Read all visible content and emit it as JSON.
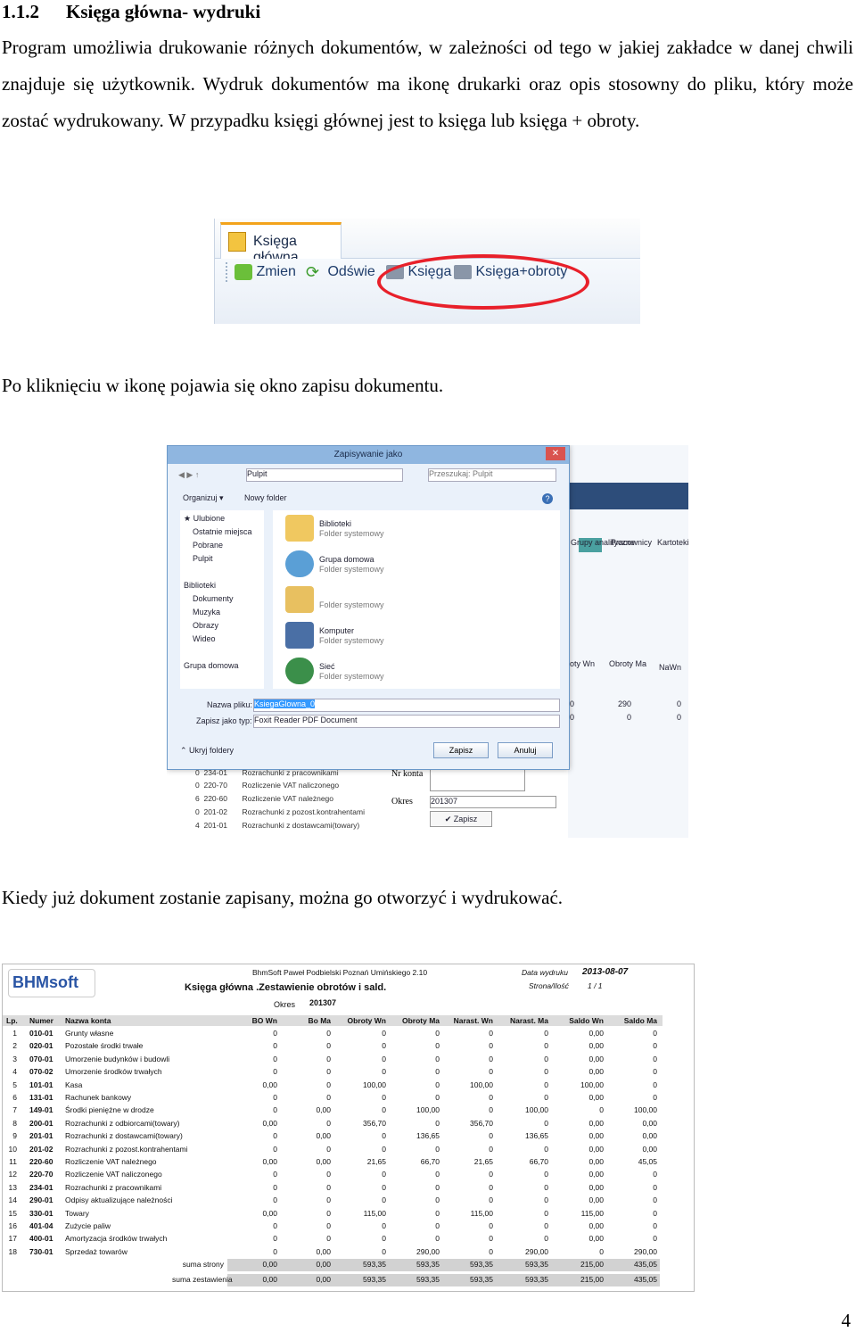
{
  "heading": {
    "number": "1.1.2",
    "title": "Księga główna- wydruki"
  },
  "paragraphs": [
    "Program umożliwia drukowanie różnych dokumentów, w zależności od tego w jakiej zakładce w danej chwili znajduje się użytkownik. Wydruk dokumentów ma ikonę drukarki oraz opis stosowny do pliku, który może zostać wydrukowany. W przypadku księgi głównej jest to księga lub księga + obroty.",
    "Po kliknięciu w ikonę pojawia się okno zapisu dokumentu.",
    "Kiedy już dokument zostanie zapisany, można go otworzyć i wydrukować."
  ],
  "toolbar": {
    "tab_label": "Księga główna",
    "buttons": [
      "Zmien",
      "Odśwież",
      "Księga",
      "Księga+obroty"
    ],
    "visible_refresh": "Odświe"
  },
  "save_dialog": {
    "title": "Zapisywanie jako",
    "close": "✕",
    "path": "Pulpit",
    "search_placeholder": "Przeszukaj: Pulpit",
    "organize": "Organizuj ▾",
    "new_folder": "Nowy folder",
    "nav_items": [
      "Ulubione",
      "Ostatnie miejsca",
      "Pobrane",
      "Pulpit",
      "Biblioteki",
      "Dokumenty",
      "Muzyka",
      "Obrazy",
      "Wideo",
      "Grupa domowa"
    ],
    "files": [
      {
        "name": "Biblioteki",
        "type": "Folder systemowy"
      },
      {
        "name": "Grupa domowa",
        "type": "Folder systemowy"
      },
      {
        "name": "",
        "type": "Folder systemowy"
      },
      {
        "name": "Komputer",
        "type": "Folder systemowy"
      },
      {
        "name": "Sieć",
        "type": "Folder systemowy"
      }
    ],
    "filename_label": "Nazwa pliku:",
    "filename_value": "KsiegaGlowna_0",
    "filetype_label": "Zapisz jako typ:",
    "filetype_value": "Foxit Reader PDF Document",
    "hide_folders": "Ukryj foldery",
    "save_button": "Zapisz",
    "cancel_button": "Anuluj"
  },
  "background_app": {
    "ribbon": [
      "Grupy analityczne",
      "Pracownicy",
      "Kartoteki analityczne"
    ],
    "columns": [
      "oty Wn",
      "Obroty Ma",
      "NaWn"
    ],
    "row1": [
      "0",
      "290",
      "0"
    ],
    "row2": [
      "0",
      "0",
      "0"
    ],
    "rows": [
      {
        "lp": "0",
        "num": "234-01",
        "name": "Rozrachunki z pracownikami"
      },
      {
        "lp": "0",
        "num": "220-70",
        "name": "Rozliczenie VAT naliczonego"
      },
      {
        "lp": "6",
        "num": "220-60",
        "name": "Rozliczenie VAT należnego"
      },
      {
        "lp": "0",
        "num": "201-02",
        "name": "Rozrachunki z pozost.kontrahentami"
      },
      {
        "lp": "4",
        "num": "201-01",
        "name": "Rozrachunki z dostawcami(towary)"
      }
    ],
    "account_label": "Nr konta",
    "period_label": "Okres",
    "period_value": "201307",
    "save_label": "Zapisz"
  },
  "report": {
    "logo": "BHMsoft",
    "company": "BhmSoft Paweł Podbielski Poznań Umińskiego 2.10",
    "title": "Księga główna .Zestawienie obrotów i sald.",
    "period_label": "Okres",
    "period": "201307",
    "print_date_label": "Data wydruku",
    "print_date": "2013-08-07",
    "page_label": "Strona/Ilość",
    "page_value": "1 / 1",
    "columns": [
      "Lp.",
      "Numer",
      "Nazwa konta",
      "BO Wn",
      "Bo Ma",
      "Obroty Wn",
      "Obroty Ma",
      "Narast. Wn",
      "Narast. Ma",
      "Saldo Wn",
      "Saldo Ma"
    ],
    "rows": [
      [
        "1",
        "010-01",
        "Grunty własne",
        "0",
        "0",
        "0",
        "0",
        "0",
        "0",
        "0,00",
        "0"
      ],
      [
        "2",
        "020-01",
        "Pozostałe środki trwałe",
        "0",
        "0",
        "0",
        "0",
        "0",
        "0",
        "0,00",
        "0"
      ],
      [
        "3",
        "070-01",
        "Umorzenie budynków i budowli",
        "0",
        "0",
        "0",
        "0",
        "0",
        "0",
        "0,00",
        "0"
      ],
      [
        "4",
        "070-02",
        "Umorzenie środków trwałych",
        "0",
        "0",
        "0",
        "0",
        "0",
        "0",
        "0,00",
        "0"
      ],
      [
        "5",
        "101-01",
        "Kasa",
        "0,00",
        "0",
        "100,00",
        "0",
        "100,00",
        "0",
        "100,00",
        "0"
      ],
      [
        "6",
        "131-01",
        "Rachunek bankowy",
        "0",
        "0",
        "0",
        "0",
        "0",
        "0",
        "0,00",
        "0"
      ],
      [
        "7",
        "149-01",
        "Środki pieniężne w drodze",
        "0",
        "0,00",
        "0",
        "100,00",
        "0",
        "100,00",
        "0",
        "100,00"
      ],
      [
        "8",
        "200-01",
        "Rozrachunki z odbiorcami(towary)",
        "0,00",
        "0",
        "356,70",
        "0",
        "356,70",
        "0",
        "0,00",
        "0,00"
      ],
      [
        "9",
        "201-01",
        "Rozrachunki z dostawcami(towary)",
        "0",
        "0,00",
        "0",
        "136,65",
        "0",
        "136,65",
        "0,00",
        "0,00"
      ],
      [
        "10",
        "201-02",
        "Rozrachunki z pozost.kontrahentami",
        "0",
        "0",
        "0",
        "0",
        "0",
        "0",
        "0,00",
        "0,00"
      ],
      [
        "11",
        "220-60",
        "Rozliczenie VAT należnego",
        "0,00",
        "0,00",
        "21,65",
        "66,70",
        "21,65",
        "66,70",
        "0,00",
        "45,05"
      ],
      [
        "12",
        "220-70",
        "Rozliczenie VAT naliczonego",
        "0",
        "0",
        "0",
        "0",
        "0",
        "0",
        "0,00",
        "0"
      ],
      [
        "13",
        "234-01",
        "Rozrachunki z pracownikami",
        "0",
        "0",
        "0",
        "0",
        "0",
        "0",
        "0,00",
        "0"
      ],
      [
        "14",
        "290-01",
        "Odpisy aktualizujące należności",
        "0",
        "0",
        "0",
        "0",
        "0",
        "0",
        "0,00",
        "0"
      ],
      [
        "15",
        "330-01",
        "Towary",
        "0,00",
        "0",
        "115,00",
        "0",
        "115,00",
        "0",
        "115,00",
        "0"
      ],
      [
        "16",
        "401-04",
        "Zużycie paliw",
        "0",
        "0",
        "0",
        "0",
        "0",
        "0",
        "0,00",
        "0"
      ],
      [
        "17",
        "400-01",
        "Amortyzacja środków trwałych",
        "0",
        "0",
        "0",
        "0",
        "0",
        "0",
        "0,00",
        "0"
      ],
      [
        "18",
        "730-01",
        "Sprzedaż towarów",
        "0",
        "0,00",
        "0",
        "290,00",
        "0",
        "290,00",
        "0",
        "290,00"
      ]
    ],
    "totals": [
      {
        "label": "suma strony",
        "values": [
          "0,00",
          "0,00",
          "593,35",
          "593,35",
          "593,35",
          "593,35",
          "215,00",
          "435,05"
        ]
      },
      {
        "label": "suma zestawienia",
        "values": [
          "0,00",
          "0,00",
          "593,35",
          "593,35",
          "593,35",
          "593,35",
          "215,00",
          "435,05"
        ]
      }
    ]
  },
  "page_number": "4"
}
